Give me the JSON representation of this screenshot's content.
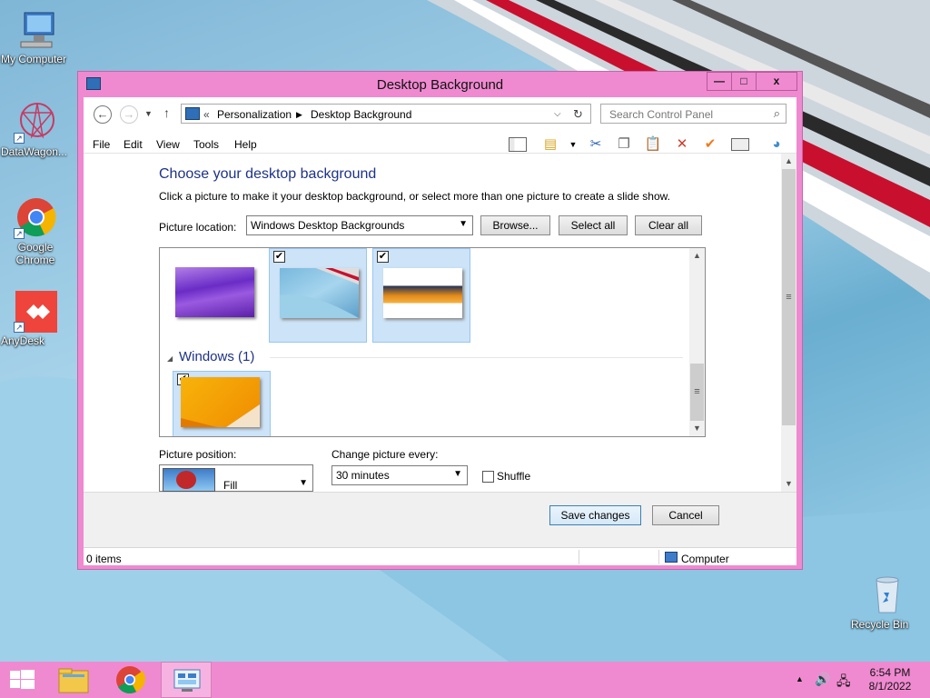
{
  "desktop": {
    "icons": [
      {
        "label": "My Computer"
      },
      {
        "label": "DataWagon..."
      },
      {
        "label": "Google Chrome"
      },
      {
        "label": "AnyDesk"
      },
      {
        "label": "Recycle Bin"
      }
    ]
  },
  "window": {
    "title": "Desktop Background",
    "controls": {
      "minimize": "—",
      "maximize": "□",
      "close": "x"
    },
    "address": {
      "prefix": "«",
      "crumbs": [
        "Personalization",
        "Desktop Background"
      ]
    },
    "search_placeholder": "Search Control Panel",
    "menu": [
      "File",
      "Edit",
      "View",
      "Tools",
      "Help"
    ],
    "heading": "Choose your desktop background",
    "description": "Click a picture to make it your desktop background, or select more than one picture to create a slide show.",
    "picture_location_label": "Picture location:",
    "picture_location_value": "Windows Desktop Backgrounds",
    "browse_label": "Browse...",
    "select_all_label": "Select all",
    "clear_all_label": "Clear all",
    "group_title": "Windows (1)",
    "picture_position_label": "Picture position:",
    "picture_position_value": "Fill",
    "change_every_label": "Change picture every:",
    "change_every_value": "30 minutes",
    "shuffle_label": "Shuffle",
    "save_label": "Save changes",
    "cancel_label": "Cancel",
    "status_items": "0 items",
    "status_computer": "Computer"
  },
  "taskbar": {
    "time": "6:54 PM",
    "date": "8/1/2022"
  },
  "colors": {
    "accent": "#ef8ad0",
    "heading": "#1e3287",
    "selection": "#cce3f8"
  }
}
